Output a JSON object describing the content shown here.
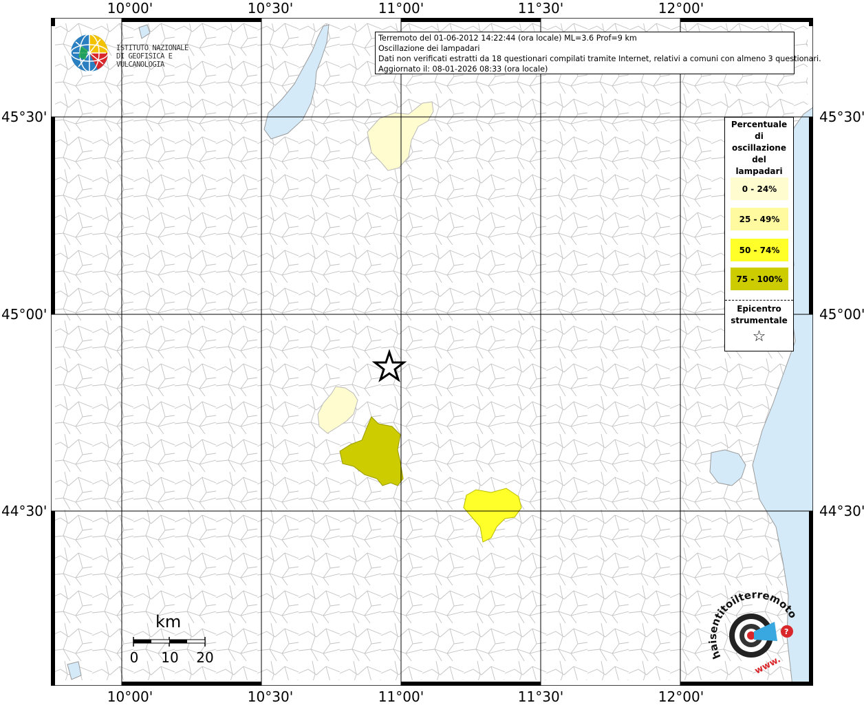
{
  "map": {
    "lon_labels": [
      "10°00'",
      "10°30'",
      "11°00'",
      "11°30'",
      "12°00'"
    ],
    "lat_labels": [
      "45°30'",
      "45°00'",
      "44°30'"
    ],
    "colors": {
      "water": "#d4eaf8",
      "border": "#b9b9b9",
      "grid": "#000000",
      "class_0_24": "#fffcd0",
      "class_25_49": "#fffaa0",
      "class_50_74": "#ffff2a",
      "class_75_100": "#cccc00"
    }
  },
  "info": {
    "line1": "Terremoto del 01-06-2012 14:22:44 (ora locale) ML=3.6 Prof=9 km",
    "line2": "Oscillazione dei lampadari",
    "line3": "Dati non verificati estratti da 18 questionari compilati tramite Internet, relativi a comuni con almeno 3 questionari.",
    "line4": "Aggiornato il: 08-01-2026 08:33 (ora locale)"
  },
  "legend": {
    "title_lines": [
      "Percentuale",
      "di",
      "oscillazione",
      "del",
      "lampadari"
    ],
    "classes": [
      {
        "label": "0 - 24%",
        "color": "#fffcd0"
      },
      {
        "label": "25 - 49%",
        "color": "#fffaa0"
      },
      {
        "label": "50 - 74%",
        "color": "#ffff2a"
      },
      {
        "label": "75 - 100%",
        "color": "#cccc00"
      }
    ],
    "epicenter_lines": [
      "Epicentro",
      "strumentale"
    ],
    "epicenter_symbol": "☆"
  },
  "logo": {
    "line1": "ISTITUTO NAZIONALE",
    "line2": "DI GEOFISICA E VULCANOLOGIA"
  },
  "scale": {
    "unit": "km",
    "ticks": [
      "0",
      "10",
      "20"
    ]
  },
  "brand": {
    "text": "haisentitoilterremoto.it",
    "url_text": "www."
  }
}
